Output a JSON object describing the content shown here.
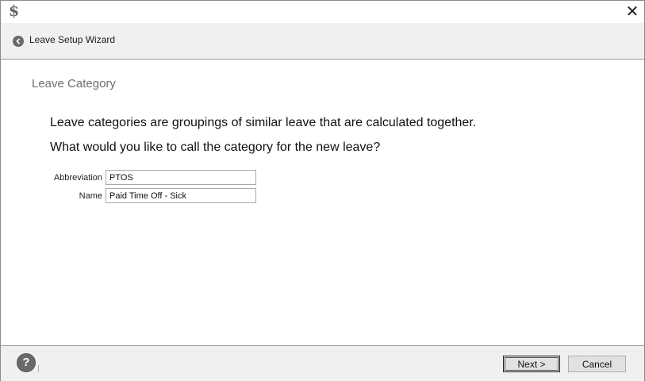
{
  "titlebar": {
    "app_icon": "$",
    "close_glyph": "✕"
  },
  "nav": {
    "back_icon": "back-arrow-icon",
    "title": "Leave Setup Wizard"
  },
  "page": {
    "heading": "Leave Category",
    "intro_line1": "Leave categories are groupings of similar leave that are calculated together.",
    "intro_line2": "What would you like to call the category for the new leave?"
  },
  "form": {
    "abbreviation_label": "Abbreviation",
    "abbreviation_value": "PTOS",
    "name_label": "Name",
    "name_value": "Paid Time Off - Sick"
  },
  "footer": {
    "help_glyph": "?",
    "next_label": "Next >",
    "cancel_label": "Cancel"
  }
}
